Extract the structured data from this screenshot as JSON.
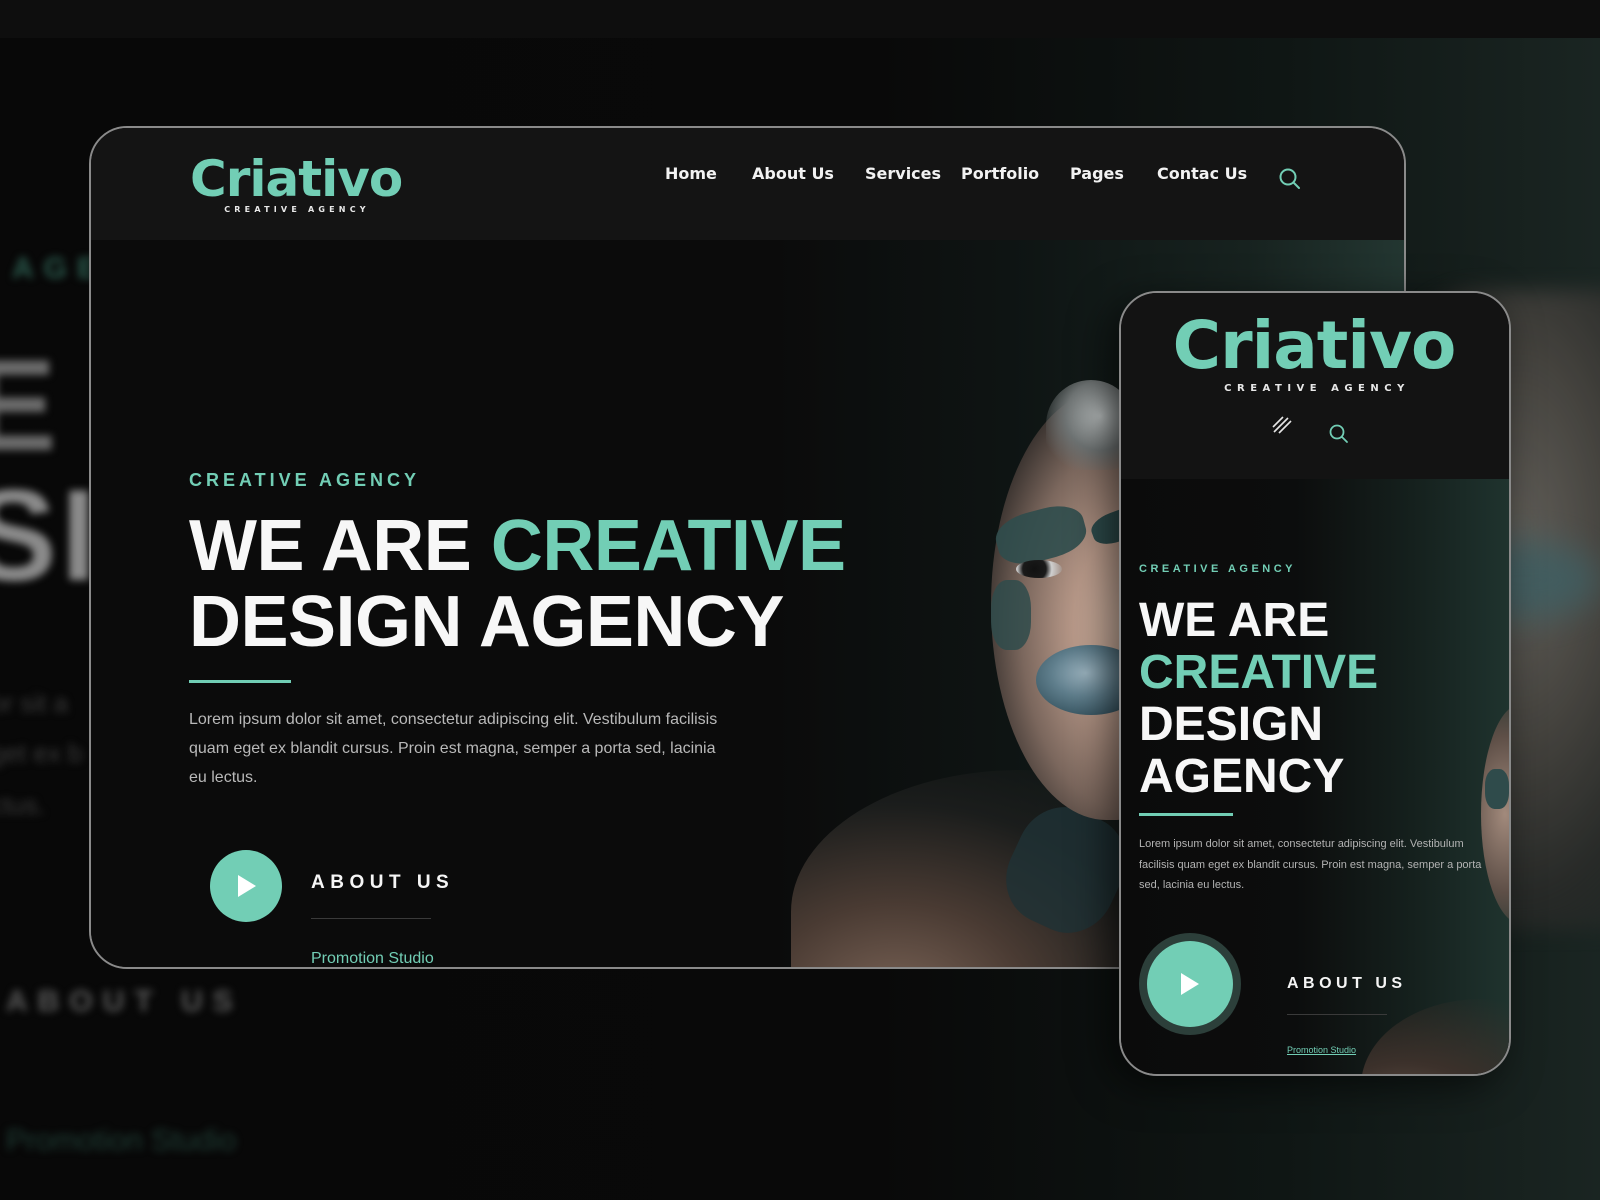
{
  "brand": {
    "name": "Criativo",
    "tagline": "CREATIVE AGENCY",
    "accent_color": "#72ceb5",
    "background_color": "#0b0b0b"
  },
  "desktop": {
    "nav": {
      "items": [
        {
          "label": "Home"
        },
        {
          "label": "About Us"
        },
        {
          "label": "Services"
        },
        {
          "label": "Portfolio"
        },
        {
          "label": "Pages"
        },
        {
          "label": "Contac Us"
        }
      ],
      "search_icon": "search-icon"
    },
    "hero": {
      "eyebrow": "CREATIVE AGENCY",
      "title_line1_white": "WE ARE ",
      "title_line1_accent": "CREATIVE",
      "title_line2": "DESIGN AGENCY",
      "description": "Lorem ipsum dolor sit amet, consectetur adipiscing elit. Vestibulum facilisis quam eget ex blandit cursus. Proin est magna, semper a porta sed, lacinia eu lectus.",
      "play_icon": "play-icon",
      "cta_label": "ABOUT US",
      "cta_sub_link": "Promotion Studio"
    }
  },
  "mobile": {
    "nav": {
      "menu_icon": "menu-icon",
      "search_icon": "search-icon"
    },
    "hero": {
      "eyebrow": "CREATIVE AGENCY",
      "title_line1": "WE ARE",
      "title_line2_accent": "CREATIVE",
      "title_line3": "DESIGN",
      "title_line4": "AGENCY",
      "description": "Lorem ipsum dolor sit amet, consectetur adipiscing elit. Vestibulum facilisis quam eget ex blandit cursus. Proin est magna, semper a porta sed, lacinia eu lectus.",
      "play_icon": "play-icon",
      "cta_label": "ABOUT US",
      "cta_sub_link": "Promotion Studio"
    }
  },
  "backdrop": {
    "blur_eyebrow": "AGE",
    "blur_title_1": "E A",
    "blur_title_2": "SI",
    "blur_desc_1": "or sit a",
    "blur_desc_2": "get ex b",
    "blur_desc_3": "ctus.",
    "blur_cta": "ABOUT US",
    "blur_promo": "Promotion Studio"
  }
}
